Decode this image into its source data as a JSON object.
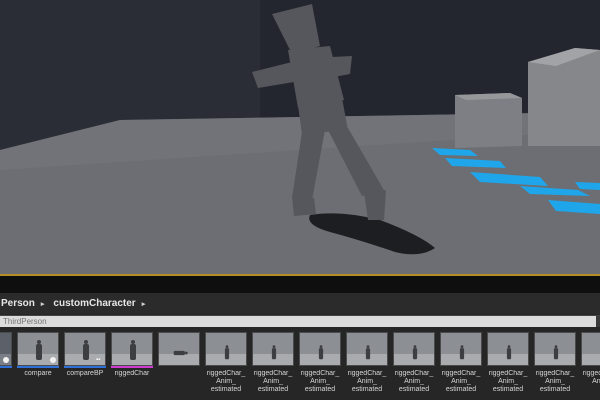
{
  "breadcrumb": {
    "items": [
      "Person",
      "customCharacter"
    ],
    "separator": "▸"
  },
  "search": {
    "placeholder": "ThirdPerson"
  },
  "assets": [
    {
      "label": "",
      "strip": "#2e6fd8",
      "dot": true,
      "thumb": "gameplay"
    },
    {
      "label": "compare",
      "strip": "#2e6fd8",
      "dot": true,
      "thumb": "character"
    },
    {
      "label": "compareBP",
      "strip": "#2e6fd8",
      "icon": "blueprint-icon",
      "thumb": "character"
    },
    {
      "label": "riggedChar",
      "strip": "#d13ad1",
      "thumb": "character"
    },
    {
      "label": "",
      "strip": "",
      "thumb": "lying"
    },
    {
      "label": "riggedChar_\nAnim_\nestimated",
      "thumb": "anim"
    },
    {
      "label": "riggedChar_\nAnim_\nestimated",
      "thumb": "anim"
    },
    {
      "label": "riggedChar_\nAnim_\nestimated",
      "thumb": "anim"
    },
    {
      "label": "riggedChar_\nAnim_\nestimated",
      "thumb": "anim"
    },
    {
      "label": "riggedChar_\nAnim_\nestimated",
      "thumb": "anim"
    },
    {
      "label": "riggedChar_\nAnim_\nestimated",
      "thumb": "anim"
    },
    {
      "label": "riggedChar_\nAnim_\nestimated",
      "thumb": "anim"
    },
    {
      "label": "riggedChar_\nAnim_\nestimated",
      "thumb": "anim"
    },
    {
      "label": "riggedChar_\nAnim_",
      "thumb": "anim"
    }
  ],
  "colors": {
    "viewport_border": "#b78d26",
    "floor_text": "#1fa6ea"
  }
}
